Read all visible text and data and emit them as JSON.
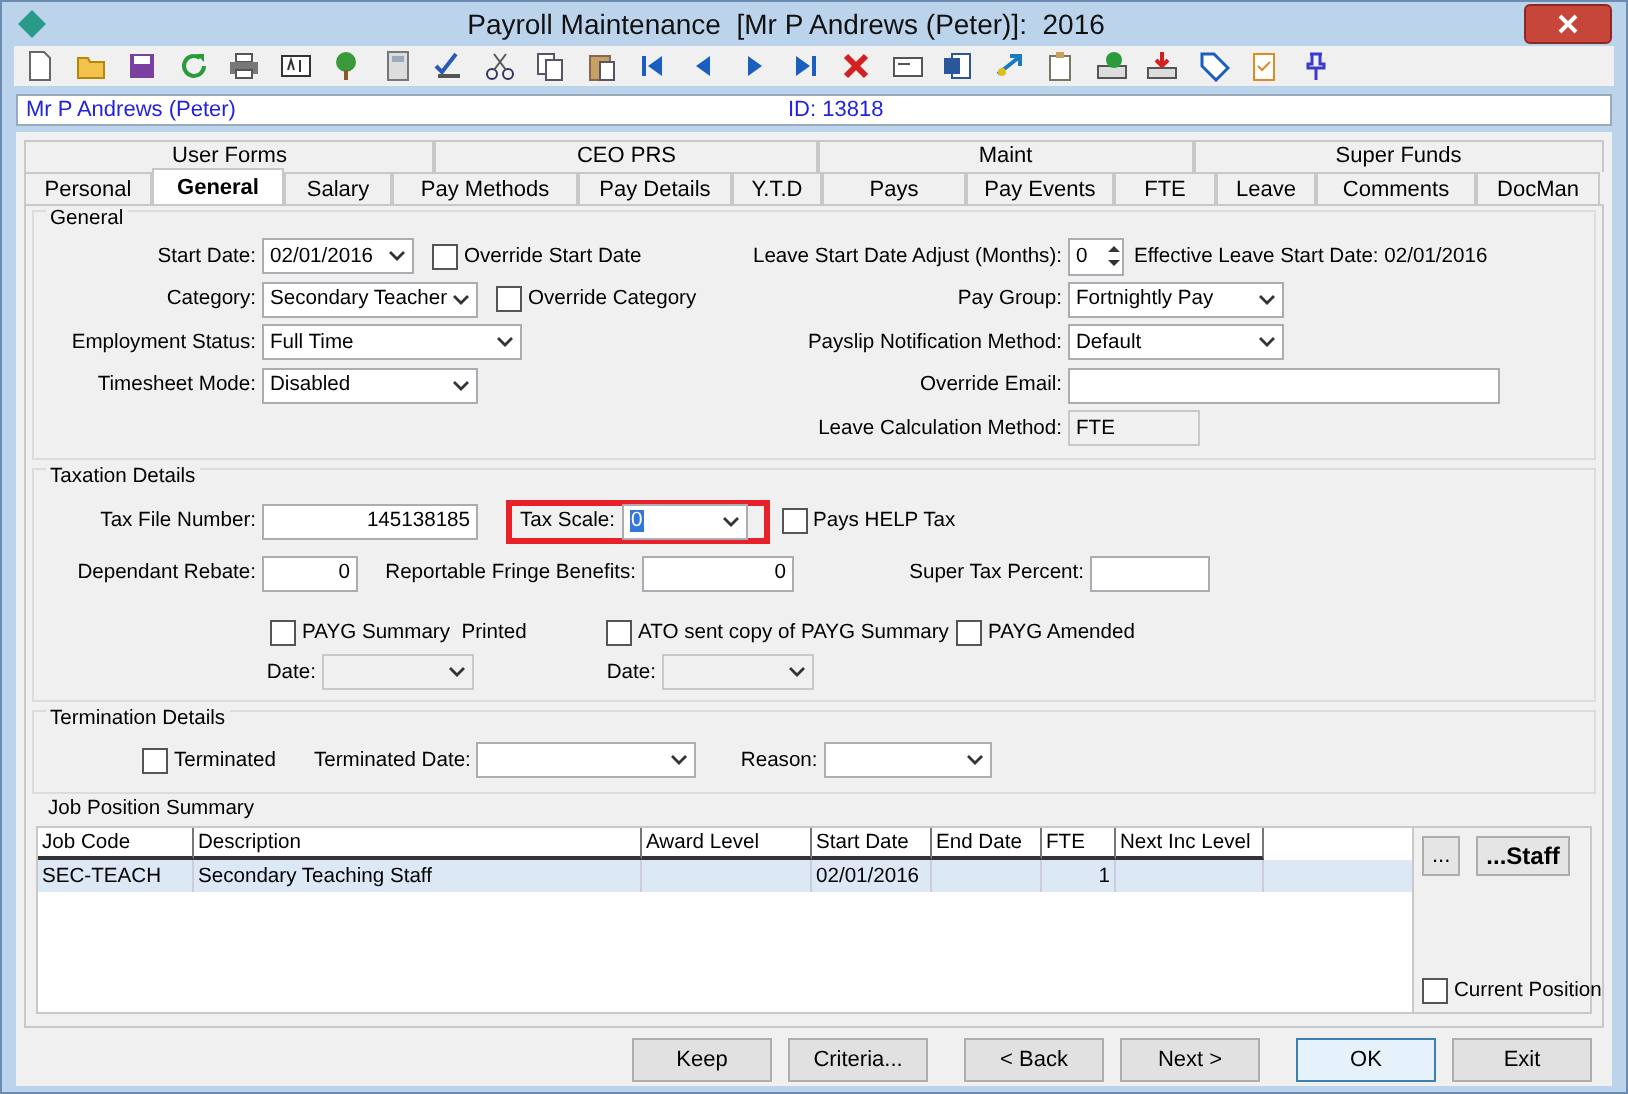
{
  "window": {
    "title": "Payroll Maintenance  [Mr P Andrews (Peter)]:  2016"
  },
  "header": {
    "name": "Mr P Andrews (Peter)",
    "id": "ID: 13818"
  },
  "tab_groups": [
    {
      "label": "User Forms"
    },
    {
      "label": "CEO PRS"
    },
    {
      "label": "Maint"
    },
    {
      "label": "Super Funds"
    }
  ],
  "tabs": [
    {
      "label": "Personal",
      "selected": false
    },
    {
      "label": "General",
      "selected": true
    },
    {
      "label": "Salary",
      "selected": false
    },
    {
      "label": "Pay Methods",
      "selected": false
    },
    {
      "label": "Pay Details",
      "selected": false
    },
    {
      "label": "Y.T.D",
      "selected": false
    },
    {
      "label": "Pays",
      "selected": false
    },
    {
      "label": "Pay Events",
      "selected": false
    },
    {
      "label": "FTE",
      "selected": false
    },
    {
      "label": "Leave",
      "selected": false
    },
    {
      "label": "Comments",
      "selected": false
    },
    {
      "label": "DocMan",
      "selected": false
    }
  ],
  "general": {
    "title": "General",
    "start_date": {
      "label": "Start Date:",
      "value": "02/01/2016"
    },
    "override_start_date": {
      "label": "Override Start Date",
      "checked": false
    },
    "category": {
      "label": "Category:",
      "value": "Secondary Teacher"
    },
    "override_category": {
      "label": "Override Category",
      "checked": false
    },
    "employment_status": {
      "label": "Employment Status:",
      "value": "Full Time"
    },
    "timesheet_mode": {
      "label": "Timesheet Mode:",
      "value": "Disabled"
    },
    "leave_start_adjust": {
      "label": "Leave Start Date Adjust (Months):",
      "value": "0"
    },
    "effective_leave_start": "Effective Leave Start Date: 02/01/2016",
    "pay_group": {
      "label": "Pay Group:",
      "value": "Fortnightly Pay"
    },
    "payslip_notification": {
      "label": "Payslip Notification Method:",
      "value": "Default"
    },
    "override_email": {
      "label": "Override Email:"
    },
    "leave_calculation": {
      "label": "Leave Calculation Method:",
      "value": "FTE"
    }
  },
  "taxation": {
    "title": "Taxation Details",
    "tax_file_number": {
      "label": "Tax File Number:",
      "value": "145138185"
    },
    "tax_scale": {
      "label": "Tax Scale:",
      "value": "0",
      "highlighted": true
    },
    "pays_help_tax": {
      "label": "Pays HELP Tax",
      "checked": false
    },
    "dependant_rebate": {
      "label": "Dependant Rebate:",
      "value": "0"
    },
    "fringe_benefits": {
      "label": "Reportable Fringe Benefits:",
      "value": "0"
    },
    "super_tax_percent": {
      "label": "Super Tax Percent:"
    },
    "payg_printed": {
      "label": "PAYG Summary  Printed",
      "checked": false
    },
    "ato_sent": {
      "label": "ATO sent copy of PAYG Summary",
      "checked": false
    },
    "payg_amended": {
      "label": "PAYG Amended",
      "checked": false
    },
    "payg_printed_date": {
      "label": "Date:",
      "disabled": true
    },
    "ato_sent_date": {
      "label": "Date:",
      "disabled": true
    }
  },
  "termination": {
    "title": "Termination Details",
    "terminated": {
      "label": "Terminated",
      "checked": false
    },
    "terminated_date": {
      "label": "Terminated Date:"
    },
    "reason": {
      "label": "Reason:"
    }
  },
  "job_positions": {
    "title": "Job Position Summary",
    "columns": [
      "Job Code",
      "Description",
      "Award Level",
      "Start Date",
      "End Date",
      "FTE",
      "Next Inc Level"
    ],
    "rows": [
      {
        "job_code": "SEC-TEACH",
        "description": "Secondary Teaching Staff",
        "start_date": "02/01/2016",
        "fte": "1",
        "selected": true
      }
    ],
    "more_button": "...",
    "staff_button": "...Staff",
    "current_position": {
      "label": "Current Position",
      "checked": false
    }
  },
  "buttons": [
    {
      "label": "Keep",
      "default": false
    },
    {
      "label": "Criteria...",
      "default": false
    },
    {
      "label": "< Back",
      "default": false
    },
    {
      "label": "Next >",
      "default": false
    },
    {
      "label": "OK",
      "default": true
    },
    {
      "label": "Exit",
      "default": false
    }
  ]
}
